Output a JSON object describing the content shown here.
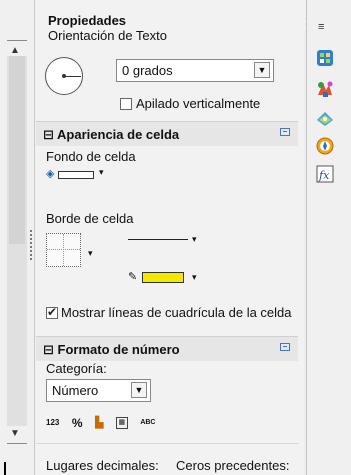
{
  "panel": {
    "title": "Propiedades",
    "close_icon": "close-icon"
  },
  "orientation": {
    "label": "Orientación de Texto",
    "degrees_value": "0 grados",
    "stack_vertical_label": "Apilado verticalmente",
    "stack_vertical_checked": false
  },
  "cell_appearance": {
    "header": "Apariencia de celda",
    "background_label": "Fondo de celda",
    "border_label": "Borde de celda",
    "line_color": "#f5e800",
    "show_grid_label": "Mostrar líneas de cuadrícula de la celda",
    "show_grid_checked": true
  },
  "number_format": {
    "header": "Formato de número",
    "category_label": "Categoría:",
    "category_value": "Número",
    "format_icons": [
      "123",
      "%",
      "currency-icon",
      "date-icon",
      "ABC"
    ],
    "decimal_places_label": "Lugares decimales:",
    "leading_zeros_label": "Ceros precedentes:"
  },
  "sidebar_tabs": [
    "menu-icon",
    "properties-icon",
    "styles-icon",
    "gallery-icon",
    "navigator-icon",
    "functions-icon"
  ]
}
